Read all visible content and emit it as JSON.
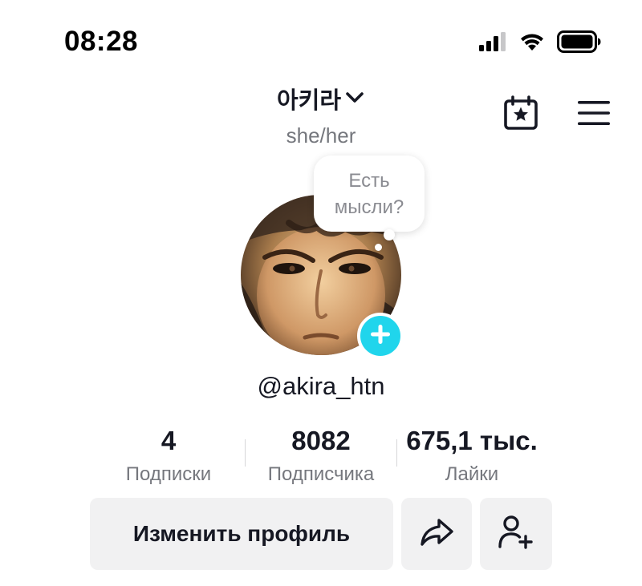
{
  "status_bar": {
    "time": "08:28",
    "signal_icon": "cellular-signal-icon",
    "wifi_icon": "wifi-icon",
    "battery_icon": "battery-icon"
  },
  "header": {
    "display_name": "아키라",
    "pronouns": "she/her",
    "dropdown_icon": "chevron-down-icon",
    "calendar_icon": "calendar-star-icon",
    "menu_icon": "hamburger-menu-icon"
  },
  "thought_bubble": {
    "text": "Есть мысли?"
  },
  "profile": {
    "username": "@akira_htn",
    "avatar_add_icon": "plus-icon"
  },
  "stats": {
    "following": {
      "value": "4",
      "label": "Подписки"
    },
    "followers": {
      "value": "8082",
      "label": "Подписчика"
    },
    "likes": {
      "value": "675,1 тыс.",
      "label": "Лайки"
    }
  },
  "actions": {
    "edit_profile_label": "Изменить профиль",
    "share_icon": "share-arrow-icon",
    "add_friend_icon": "add-friend-icon"
  },
  "colors": {
    "accent": "#20d5ec",
    "text_primary": "#161823",
    "text_secondary": "#75777d",
    "button_bg": "#f1f1f2"
  }
}
